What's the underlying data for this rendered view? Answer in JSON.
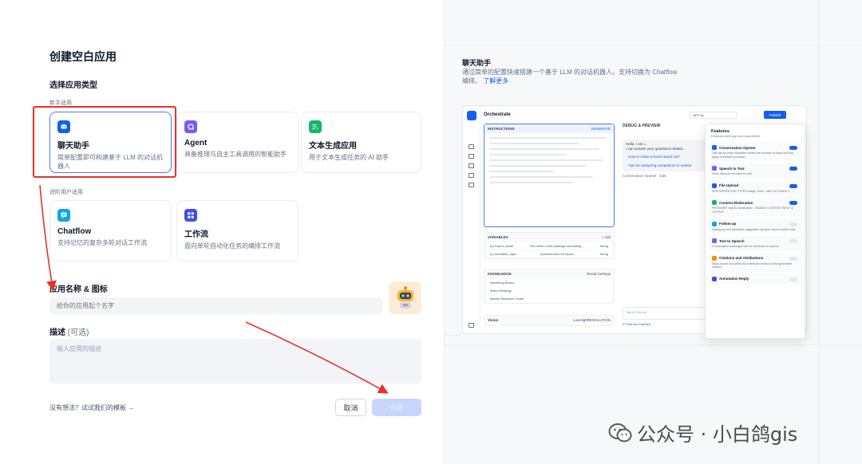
{
  "dialog": {
    "title": "创建空白应用",
    "type_section_title": "选择应用类型",
    "beginner_label": "新手适用",
    "advanced_label": "进阶用户适用",
    "app_types": [
      {
        "name": "聊天助手",
        "desc": "简单配置即可构建基于 LLM 的对话机器人",
        "icon_color": "#155eef",
        "icon": "chat-bot-icon"
      },
      {
        "name": "Agent",
        "desc": "具备推理与自主工具调用的智能助手",
        "icon_color": "#7a5af8",
        "icon": "agent-icon"
      },
      {
        "name": "文本生成应用",
        "desc": "用于文本生成任务的 AI 助手",
        "icon_color": "#12b76a",
        "icon": "text-gen-icon"
      },
      {
        "name": "Chatflow",
        "desc": "支持记忆的复杂多轮对话工作流",
        "icon_color": "#0ba5ec",
        "icon": "chatflow-icon"
      },
      {
        "name": "工作流",
        "desc": "面向单轮自动化任务的编排工作流",
        "icon_color": "#444ce7",
        "icon": "workflow-icon"
      }
    ],
    "name_label": "应用名称 & 图标",
    "name_placeholder": "给你的应用起个名字",
    "desc_label": "描述",
    "desc_optional": "(可选)",
    "desc_placeholder": "输入应用的描述",
    "template_link": "没有想法？试试我们的模板 →",
    "cancel_label": "取消",
    "create_label": "创建"
  },
  "preview_panel": {
    "title": "聊天助手",
    "desc": "通过简单的配置快速搭建一个基于 LLM 的对话机器人。支持切换为 Chatflow 编排。",
    "learn_more": "了解更多",
    "mock": {
      "header": "Orchestrate",
      "model": "GPT-4o",
      "publish": "Publish",
      "instructions": "INSTRUCTIONS",
      "generate": "GENERATE",
      "variables_title": "VARIABLES",
      "add": "+ Add",
      "variables": [
        {
          "name": "{x} expert_name",
          "hint": "The name of the strategic consulting...",
          "type": "String"
        },
        {
          "name": "{x} unrelated_topic",
          "hint": "A placeholder for topics...",
          "type": "String"
        }
      ],
      "knowledge_title": "KNOWLEDGE",
      "knowledge_settings": "Recall Settings",
      "knowledge": [
        "Marketing Basics",
        "Brand Strategy",
        "Market Research Guide"
      ],
      "vision": "Vision",
      "resolution": "RESOLUTION",
      "high": "High",
      "low": "Low",
      "debug_title": "DEBUG & PREVIEW",
      "chat_hello": "Hello, I am i...",
      "chat_line": "I can answer your questions related...",
      "suggestions": [
        "How to make a brand stand out?",
        "Tips for analyzing competitors in market"
      ],
      "opener_note": "Conversation Opener · Edit",
      "talk_placeholder": "Talk to Dify bot",
      "features_enabled": "4 Features Enabled",
      "features_title": "Features",
      "features_sub": "Enhance web app user experience",
      "features": [
        {
          "name": "Conversation Opener",
          "desc": "Tips are an entry extraction model that accepts an input text and (type) of entities to extract.",
          "color": "#155eef",
          "on": true
        },
        {
          "name": "Speech to Text",
          "desc": "Voice input can be used in chat.",
          "color": "#7a5af8",
          "on": true
        },
        {
          "name": "File Upload",
          "desc": "SUPPORTED FILE TYPES Image, Docs · MAX UPLOADS 3",
          "color": "#155eef",
          "on": true
        },
        {
          "name": "Content Moderation",
          "desc": "PROVIDER OpenAI Moderation · ENABLE CONTENT INPUT & OUTPUT",
          "color": "#12b76a",
          "on": true
        },
        {
          "name": "Follow-up",
          "desc": "Setting up next questions suggestion can give users a better chat.",
          "color": "#0ba5ec",
          "on": false
        },
        {
          "name": "Text to Speech",
          "desc": "Conversation messages can be converted to speech.",
          "color": "#7a5af8",
          "on": false
        },
        {
          "name": "Citations and Attributions",
          "desc": "Show source document and attributed section of the generated content.",
          "color": "#f79009",
          "on": false
        },
        {
          "name": "Annotation Reply",
          "desc": "",
          "color": "#444ce7",
          "on": false
        }
      ]
    }
  },
  "watermark": {
    "text": "公众号 · 小白鸽gis"
  }
}
